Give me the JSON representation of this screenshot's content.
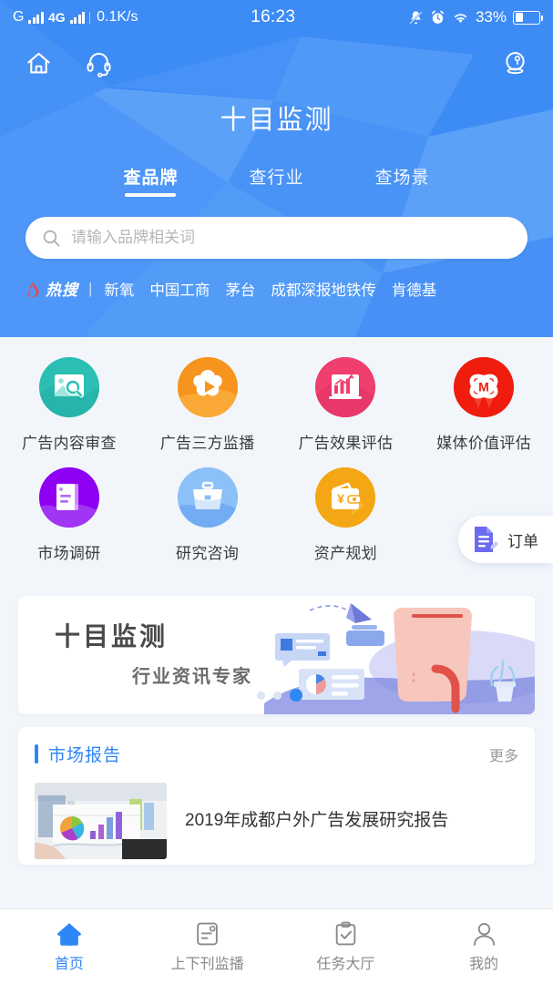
{
  "status_bar": {
    "carrier_letter": "G",
    "network_type": "4G",
    "speed": "0.1K/s",
    "time": "16:23",
    "battery_percent": "33%",
    "icons": [
      "signal-bars-icon",
      "network-4g-icon",
      "signal-bars-icon",
      "mute-bell-icon",
      "alarm-clock-icon",
      "wifi-icon",
      "battery-icon"
    ]
  },
  "header": {
    "title": "十目监测",
    "home_icon": "home-icon",
    "support_icon": "headset-icon",
    "avatar_icon": "user-avatar-icon",
    "accent_color": "#3d8bf5",
    "tabs": [
      {
        "label": "查品牌",
        "active": true
      },
      {
        "label": "查行业",
        "active": false
      },
      {
        "label": "查场景",
        "active": false
      }
    ],
    "search": {
      "placeholder": "请输入品牌相关词",
      "value": "",
      "icon": "search-icon"
    },
    "hot_search": {
      "label": "热搜",
      "flame_icon": "flame-icon",
      "separator": "|",
      "keywords": [
        "新氧",
        "中国工商",
        "茅台",
        "成都深报地铁传",
        "肯德基"
      ]
    }
  },
  "grid": {
    "rows": [
      [
        {
          "label": "广告内容审查",
          "icon": "image-search-icon",
          "color": "#2bbfb3"
        },
        {
          "label": "广告三方监播",
          "icon": "share-broadcast-icon",
          "color": "#f7941e"
        },
        {
          "label": "广告效果评估",
          "icon": "bar-chart-icon",
          "color": "#ef3f6e"
        },
        {
          "label": "媒体价值评估",
          "icon": "media-atom-m-icon",
          "color": "#f01c0e"
        }
      ],
      [
        {
          "label": "市场调研",
          "icon": "document-research-icon",
          "color": "#8f00f2"
        },
        {
          "label": "研究咨询",
          "icon": "briefcase-icon",
          "color": "#78b2f5"
        },
        {
          "label": "资产规划",
          "icon": "wallet-yuan-icon",
          "color": "#f5a614"
        }
      ]
    ]
  },
  "order_fab": {
    "label": "订单",
    "icon": "order-document-icon",
    "color": "#6b6bf0"
  },
  "banner": {
    "title": "十目监测",
    "subtitle": "行业资讯专家",
    "illustration": "desk-monitor-illustration",
    "dots": 3,
    "active_dot": 3
  },
  "market_report": {
    "section_title": "市场报告",
    "more_label": "更多",
    "items": [
      {
        "title": "2019年成都户外广告发展研究报告",
        "thumbnail": "chart-report-photo"
      }
    ]
  },
  "tabbar": {
    "items": [
      {
        "label": "首页",
        "icon": "home-filled-icon",
        "active": true
      },
      {
        "label": "上下刊监播",
        "icon": "document-note-icon",
        "active": false
      },
      {
        "label": "任务大厅",
        "icon": "clipboard-check-icon",
        "active": false
      },
      {
        "label": "我的",
        "icon": "person-icon",
        "active": false
      }
    ],
    "active_color": "#2f86f6",
    "inactive_color": "#8a8a8a"
  }
}
